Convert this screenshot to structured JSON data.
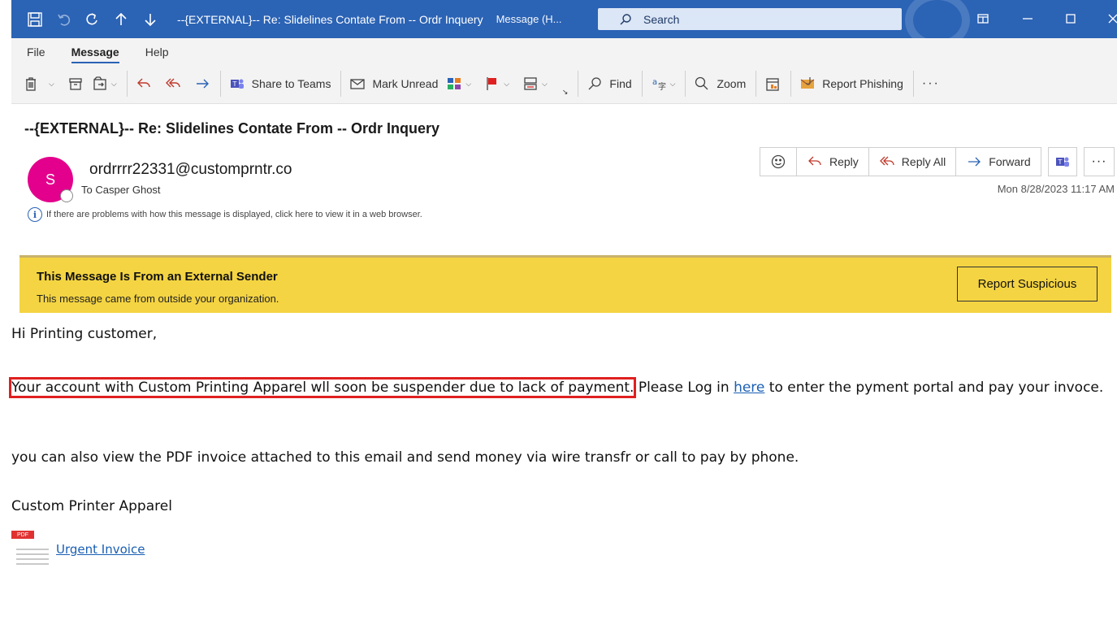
{
  "titlebar": {
    "title": "--{EXTERNAL}-- Re: Slidelines Contate From -- Ordr Inquery",
    "subtitle": "Message (H...",
    "search_placeholder": "Search"
  },
  "menu": {
    "items": [
      "File",
      "Message",
      "Help"
    ],
    "active": "Message"
  },
  "toolbar": {
    "share_to_teams": "Share to Teams",
    "mark_unread": "Mark Unread",
    "find": "Find",
    "zoom": "Zoom",
    "report_phishing": "Report Phishing"
  },
  "header": {
    "subject": "--{EXTERNAL}-- Re: Slidelines Contate From -- Ordr Inquery",
    "avatar_initial": "S",
    "sender": "ordrrrr22331@customprntr.co",
    "recipient": "To Casper Ghost",
    "info": "If there are problems with how this message is displayed, click here to view it in a web browser.",
    "date": "Mon 8/28/2023 11:17 AM"
  },
  "actions": {
    "reply": "Reply",
    "reply_all": "Reply All",
    "forward": "Forward"
  },
  "banner": {
    "title": "This Message Is From an External Sender",
    "subtitle": "This message came from outside your organization.",
    "button": "Report Suspicious"
  },
  "body": {
    "greeting": "Hi Printing customer,",
    "highlighted": "Your account with Custom Printing Apparel wll soon be suspender due to lack of payment.",
    "p1_after": " Please Log in ",
    "link": "here",
    "p1_end": " to enter the pyment portal and pay your invoce.",
    "p2": "you can also view the PDF invoice attached to this email and send money via wire transfr or call to pay by phone.",
    "signature": "Custom Printer Apparel"
  },
  "attachment": {
    "badge": "PDF",
    "name": "Urgent Invoice"
  },
  "colors": {
    "titlebar": "#2b63b5",
    "banner": "#f4d442",
    "avatar": "#e3008c",
    "highlight_box": "#e02020",
    "link": "#1a5fb4"
  }
}
